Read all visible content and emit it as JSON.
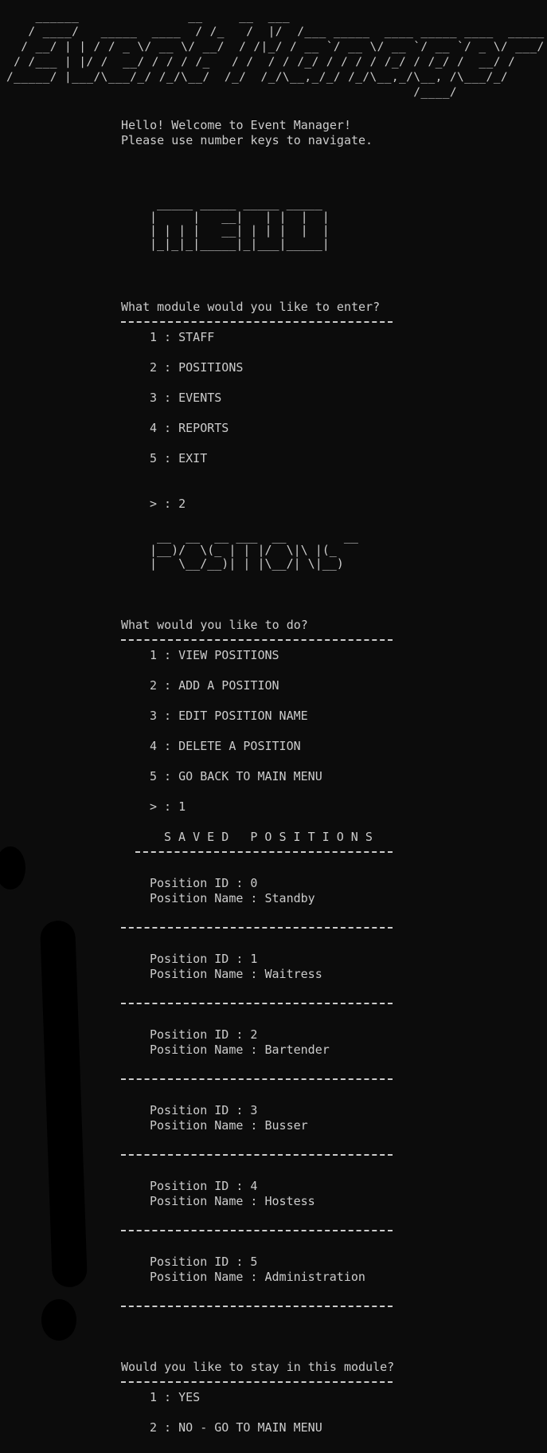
{
  "banner_ascii": "    ______               __     __  ___\n   / ____/   _____  ____  / /_   /  |/  /___ _____  ____ _____ ____  _____\n  / __/ | | / / _ \\/ __ \\/ __/  / /|_/ / __ `/ __ \\/ __ `/ __ `/ _ \\/ ___/\n / /___ | |/ /  __/ / / / /_   / /  / / /_/ / / / / /_/ / /_/ /  __/ /\n/_____/ |___/\\___/_/ /_/\\__/  /_/  /_/\\__,_/_/ /_/\\__,_/\\__, /\\___/_/\n                                                        /____/",
  "greeting": {
    "line1": "Hello! Welcome to Event Manager!",
    "line2": "Please use number keys to navigate."
  },
  "menu_ascii": " _____ _____ _____ _____\n|     |   __|   | |  |  |\n| | | |   __| | | |  |  |\n|_|_|_|_____|_|___|_____|",
  "main_menu": {
    "prompt": "What module would you like to enter?",
    "options": [
      "1 : STAFF",
      "2 : POSITIONS",
      "3 : EVENTS",
      "4 : REPORTS",
      "5 : EXIT"
    ],
    "input": "> : 2"
  },
  "position_ascii": " __  __  __ ___  __        __\n|__)/  \\(_ | | |/  \\|\\ |(_\n|   \\__/__)| | |\\__/| \\|__)",
  "positions_menu": {
    "prompt": "What would you like to do?",
    "options": [
      "1 : VIEW POSITIONS",
      "2 : ADD A POSITION",
      "3 : EDIT POSITION NAME",
      "4 : DELETE A POSITION",
      "5 : GO BACK TO MAIN MENU"
    ],
    "input": "> : 1"
  },
  "saved_positions": {
    "heading": "S A V E D   P O S I T I O N S",
    "id_label": "Position ID : ",
    "name_label": "Position Name : ",
    "items": [
      {
        "id_line": "Position ID : 0",
        "name_line": "Position Name : Standby"
      },
      {
        "id_line": "Position ID : 1",
        "name_line": "Position Name : Waitress"
      },
      {
        "id_line": "Position ID : 2",
        "name_line": "Position Name : Bartender"
      },
      {
        "id_line": "Position ID : 3",
        "name_line": "Position Name : Busser"
      },
      {
        "id_line": "Position ID : 4",
        "name_line": "Position Name : Hostess"
      },
      {
        "id_line": "Position ID : 5",
        "name_line": "Position Name : Administration"
      }
    ]
  },
  "stay_menu": {
    "prompt": "Would you like to stay in this module?",
    "options": [
      "1 : YES",
      "2 : NO - GO TO MAIN MENU"
    ]
  },
  "colors": {
    "background": "#0c0c0c",
    "text": "#cccccc"
  }
}
